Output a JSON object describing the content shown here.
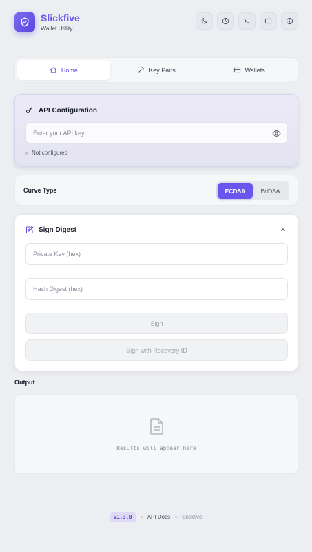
{
  "app": {
    "name": "Slickfive",
    "subtitle": "Wallet Utility"
  },
  "header_icons": [
    "moon-icon",
    "clock-icon",
    "terminal-icon",
    "screen-icon",
    "info-icon"
  ],
  "tabs": [
    {
      "label": "Home",
      "icon": "home-icon",
      "active": true
    },
    {
      "label": "Key Pairs",
      "icon": "key-icon",
      "active": false
    },
    {
      "label": "Wallets",
      "icon": "card-icon",
      "active": false
    }
  ],
  "api": {
    "title": "API Configuration",
    "placeholder": "Enter your API key",
    "status": "Not configured"
  },
  "curve": {
    "label": "Curve Type",
    "options": [
      "ECDSA",
      "EdDSA"
    ],
    "selected": "ECDSA"
  },
  "sign": {
    "title": "Sign Digest",
    "private_key_placeholder": "Private Key (hex)",
    "hash_placeholder": "Hash Digest (hex)",
    "sign_label": "Sign",
    "sign_recovery_label": "Sign with Recovery ID"
  },
  "output": {
    "label": "Output",
    "empty_message": "Results will appear here"
  },
  "footer": {
    "version": "v1.3.0",
    "docs": "API Docs",
    "brand": "Slickfive"
  },
  "colors": {
    "accent": "#6a56ec",
    "background": "#eceef2"
  }
}
